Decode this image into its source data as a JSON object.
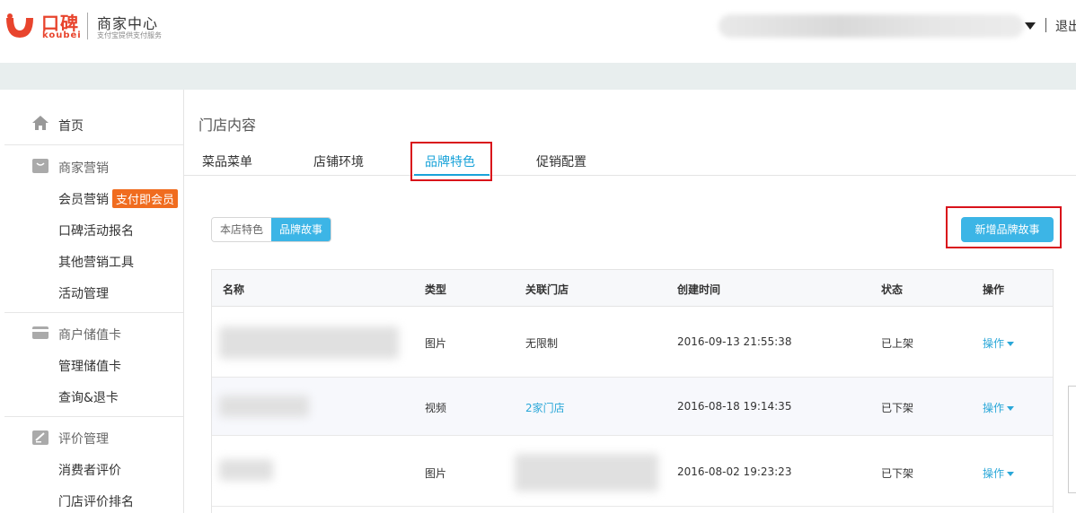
{
  "header": {
    "logo_cn": "口碑",
    "logo_en": "koubei",
    "brand_title": "商家中心",
    "brand_sub": "支付宝提供支付服务",
    "logout": "退出",
    "brand_color": "#e8442d"
  },
  "sidebar": {
    "home": "首页",
    "groups": [
      {
        "title": "商家营销",
        "icon": "gift-icon",
        "items": [
          "会员营销",
          "口碑活动报名",
          "其他营销工具",
          "活动管理"
        ],
        "badge": "支付即会员"
      },
      {
        "title": "商户储值卡",
        "icon": "card-icon",
        "items": [
          "管理储值卡",
          "查询&退卡"
        ]
      },
      {
        "title": "评价管理",
        "icon": "edit-icon",
        "items": [
          "消费者评价",
          "门店评价排名"
        ]
      }
    ]
  },
  "main": {
    "page_title": "门店内容",
    "tabs": [
      "菜品菜单",
      "店铺环境",
      "品牌特色",
      "促销配置"
    ],
    "active_tab": "品牌特色",
    "segment": [
      "本店特色",
      "品牌故事"
    ],
    "add_button": "新增品牌故事",
    "accent_color": "#3cb5e6",
    "table": {
      "headers": [
        "名称",
        "类型",
        "关联门店",
        "创建时间",
        "状态",
        "操作"
      ],
      "rows": [
        {
          "type": "图片",
          "store": "无限制",
          "created": "2016-09-13 21:55:38",
          "status": "已上架",
          "op": "操作"
        },
        {
          "type": "视频",
          "store": "2家门店",
          "created": "2016-08-18 19:14:35",
          "status": "已下架",
          "op": "操作"
        },
        {
          "type": "图片",
          "store": "",
          "created": "2016-08-02 19:23:23",
          "status": "已下架",
          "op": "操作"
        }
      ]
    }
  }
}
